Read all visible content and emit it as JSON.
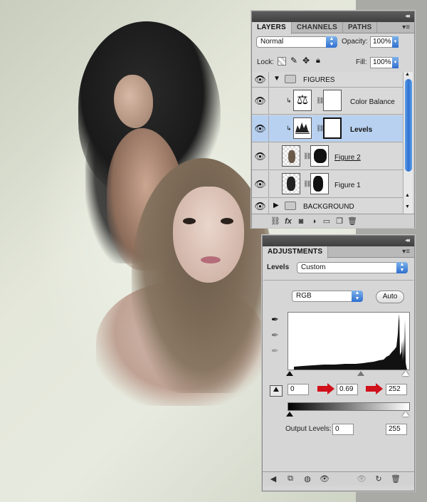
{
  "layers_panel": {
    "tabs": [
      "LAYERS",
      "CHANNELS",
      "PATHS"
    ],
    "blend_mode": "Normal",
    "opacity_label": "Opacity:",
    "opacity_value": "100%",
    "lock_label": "Lock:",
    "fill_label": "Fill:",
    "fill_value": "100%",
    "layers": [
      {
        "name": "FIGURES",
        "kind": "group",
        "expanded": true
      },
      {
        "name": "Color Balance",
        "kind": "adjustment"
      },
      {
        "name": "Levels",
        "kind": "adjustment",
        "selected": true
      },
      {
        "name": "Figure 2",
        "kind": "layer"
      },
      {
        "name": "Figure 1",
        "kind": "layer"
      },
      {
        "name": "BACKGROUND",
        "kind": "group",
        "expanded": false
      }
    ]
  },
  "adjustments_panel": {
    "tab": "ADJUSTMENTS",
    "preset_label": "Levels",
    "preset_value": "Custom",
    "channel_value": "RGB",
    "auto_label": "Auto",
    "input_black": "0",
    "input_gamma": "0.69",
    "input_white": "252",
    "output_label": "Output Levels:",
    "output_black": "0",
    "output_white": "255"
  },
  "colors": {
    "selection": "#b9d1f0",
    "panel_bg": "#d6d6d6",
    "title_bar": "#4a4a4a",
    "accent_blue": "#2f6fcf",
    "annotation_red": "#d0101a"
  }
}
